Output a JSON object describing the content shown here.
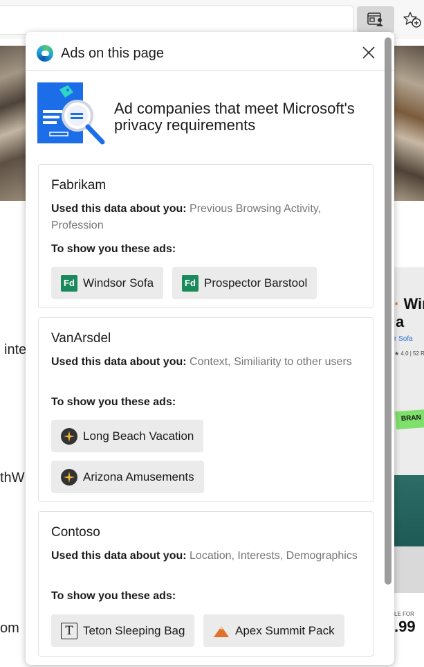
{
  "browser": {
    "ads_button_icon": "ads-on-page-icon",
    "favorites_button_icon": "add-favorite-icon"
  },
  "background_page": {
    "text_fragments": [
      "inte",
      "thW",
      "om"
    ],
    "ad_title_1": "Wir",
    "ad_title_2": "a",
    "ad_subtitle": "r Sofa",
    "ad_rating": "4.0 | 52 R",
    "ad_badge": "BRAN",
    "price_label": "LE FOR",
    "price": ".99"
  },
  "panel": {
    "title": "Ads on this page",
    "close_icon": "close-icon",
    "hero_title": "Ad companies that meet Microsoft's privacy requirements",
    "used_label": "Used this data about you:",
    "show_label": "To show you these ads:",
    "companies": [
      {
        "name": "Fabrikam",
        "data_used": "Previous Browsing Activity, Profession",
        "ads": [
          {
            "label": "Windsor Sofa",
            "icon": "fabrikam-logo-icon",
            "icon_text": "Fd"
          },
          {
            "label": "Prospector Barstool",
            "icon": "fabrikam-logo-icon",
            "icon_text": "Fd"
          }
        ]
      },
      {
        "name": "VanArsdel",
        "data_used": "Context, Similiarity to other users",
        "ads": [
          {
            "label": "Long Beach Vacation",
            "icon": "airplane-icon"
          },
          {
            "label": "Arizona Amusements",
            "icon": "airplane-icon"
          }
        ]
      },
      {
        "name": "Contoso",
        "data_used": "Location, Interests, Demographics",
        "ads": [
          {
            "label": "Teton Sleeping Bag",
            "icon": "teton-logo-icon",
            "icon_text": "T"
          },
          {
            "label": "Apex Summit Pack",
            "icon": "mountain-icon"
          }
        ]
      }
    ]
  },
  "colors": {
    "accent_blue": "#1c6ee8",
    "fabrikam_green": "#1a8a5c",
    "chip_background": "#ebebeb",
    "mountain_orange": "#e0732a"
  }
}
